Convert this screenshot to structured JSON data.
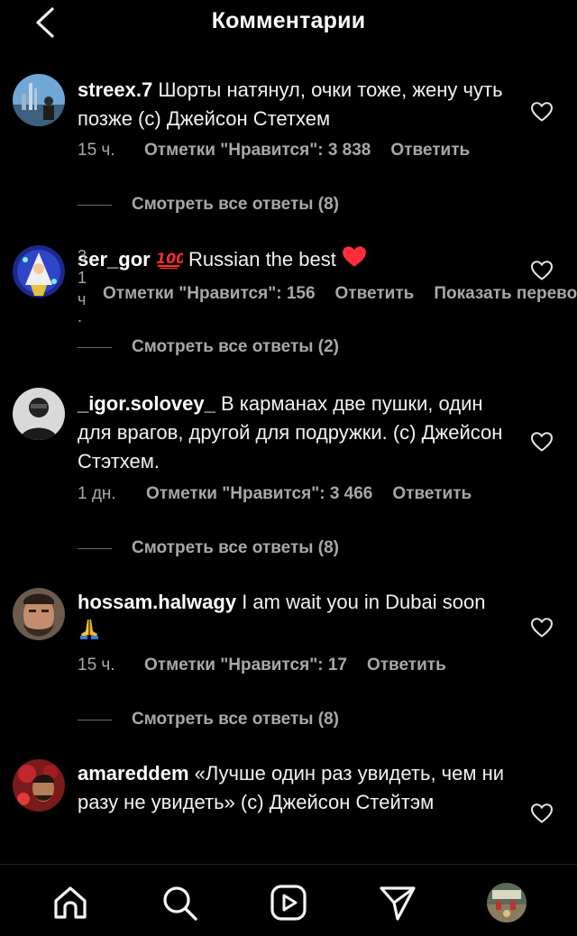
{
  "header": {
    "title": "Комментарии"
  },
  "comments": [
    {
      "username": "streex.7",
      "text": "Шорты натянул, очки тоже, жену чуть позже (с) Джейсон Стетхем",
      "time": "15 ч.",
      "likes": "Отметки \"Нравится\": 3 838",
      "reply": "Ответить",
      "view_replies": "Смотреть все ответы (8)"
    },
    {
      "username": "ser_gor",
      "emoji": "💯",
      "text": "Russian the best",
      "time_chars": [
        "3",
        "1",
        "ч",
        "."
      ],
      "likes": "Отметки \"Нравится\": 156",
      "reply": "Ответить",
      "translate": "Показать перевод",
      "view_replies": "Смотреть все ответы (2)"
    },
    {
      "username": "_igor.solovey_",
      "text": "В карманах две пушки, один для врагов, другой для подружки. (с) Джейсон Стэтхем.",
      "time": "1 дн.",
      "likes": "Отметки \"Нравится\": 3 466",
      "reply": "Ответить",
      "view_replies": "Смотреть все ответы (8)"
    },
    {
      "username": "hossam.halwagy",
      "text": "I am wait you in Dubai soon",
      "time": "15 ч.",
      "likes": "Отметки \"Нравится\": 17",
      "reply": "Ответить",
      "view_replies": "Смотреть все ответы (8)"
    },
    {
      "username": "amareddem",
      "text": "«Лучше один раз увидеть, чем ни разу не увидеть» (с) Джейсон Стейтэм"
    }
  ],
  "nav": {
    "items": [
      "home-icon",
      "search-icon",
      "reels-icon",
      "direct-icon",
      "profile-avatar"
    ]
  },
  "colors": {
    "background": "#000000",
    "text": "#f5f5f5",
    "secondary": "#a8a8a8",
    "heart_red": "#ff3040"
  }
}
